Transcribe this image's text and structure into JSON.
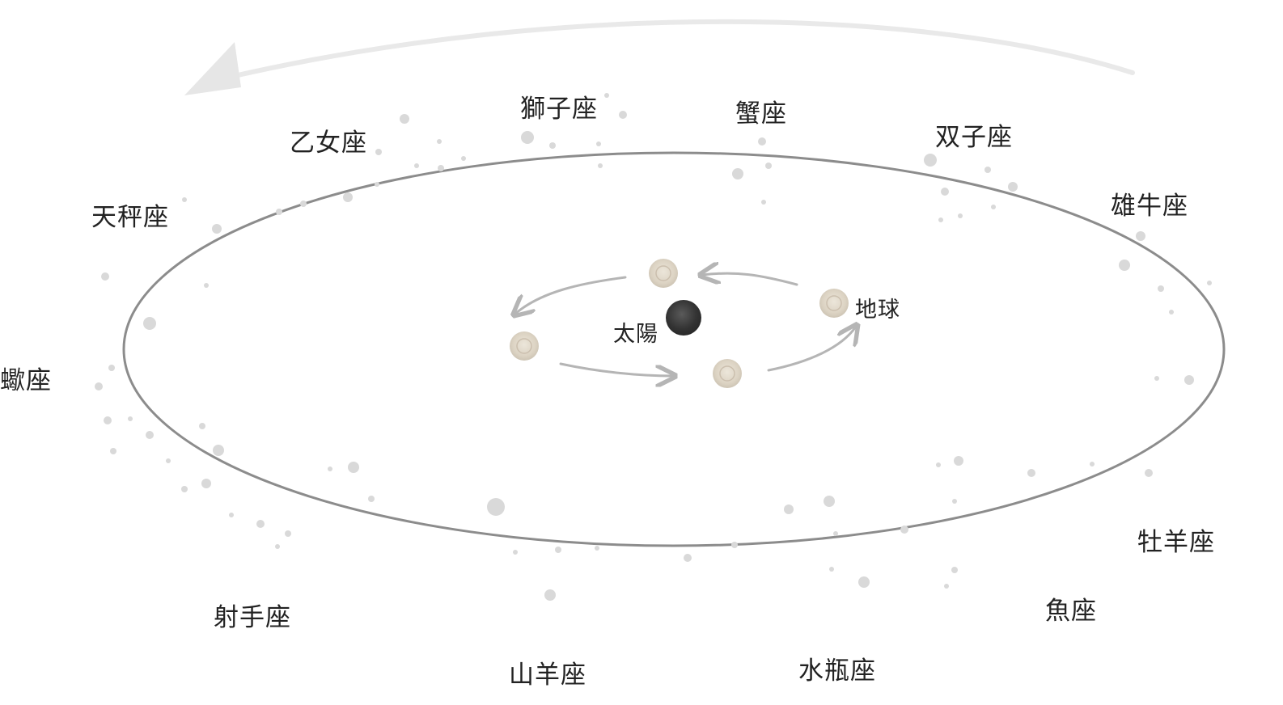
{
  "colors": {
    "ellipse": "#8c8c8c",
    "big_arrow": "#e9e9e9",
    "small_arrows": "#b5b5b5",
    "sun": "#3b3b3b",
    "earth": "#ddd6c8",
    "specks": "#d9d9d9",
    "text": "#222222"
  },
  "zodiac": {
    "leo": "獅子座",
    "cancer": "蟹座",
    "virgo": "乙女座",
    "gemini": "双子座",
    "libra": "天秤座",
    "taurus": "雄牛座",
    "scorpio": "蠍座",
    "aries": "牡羊座",
    "sagittarius": "射手座",
    "pisces": "魚座",
    "capricorn": "山羊座",
    "aquarius": "水瓶座"
  },
  "center": {
    "sun_label": "太陽",
    "earth_label": "地球"
  },
  "icons": [
    "big-orbit-arrow-icon",
    "sun-icon",
    "earth-icon",
    "orbit-arrow-icon"
  ]
}
